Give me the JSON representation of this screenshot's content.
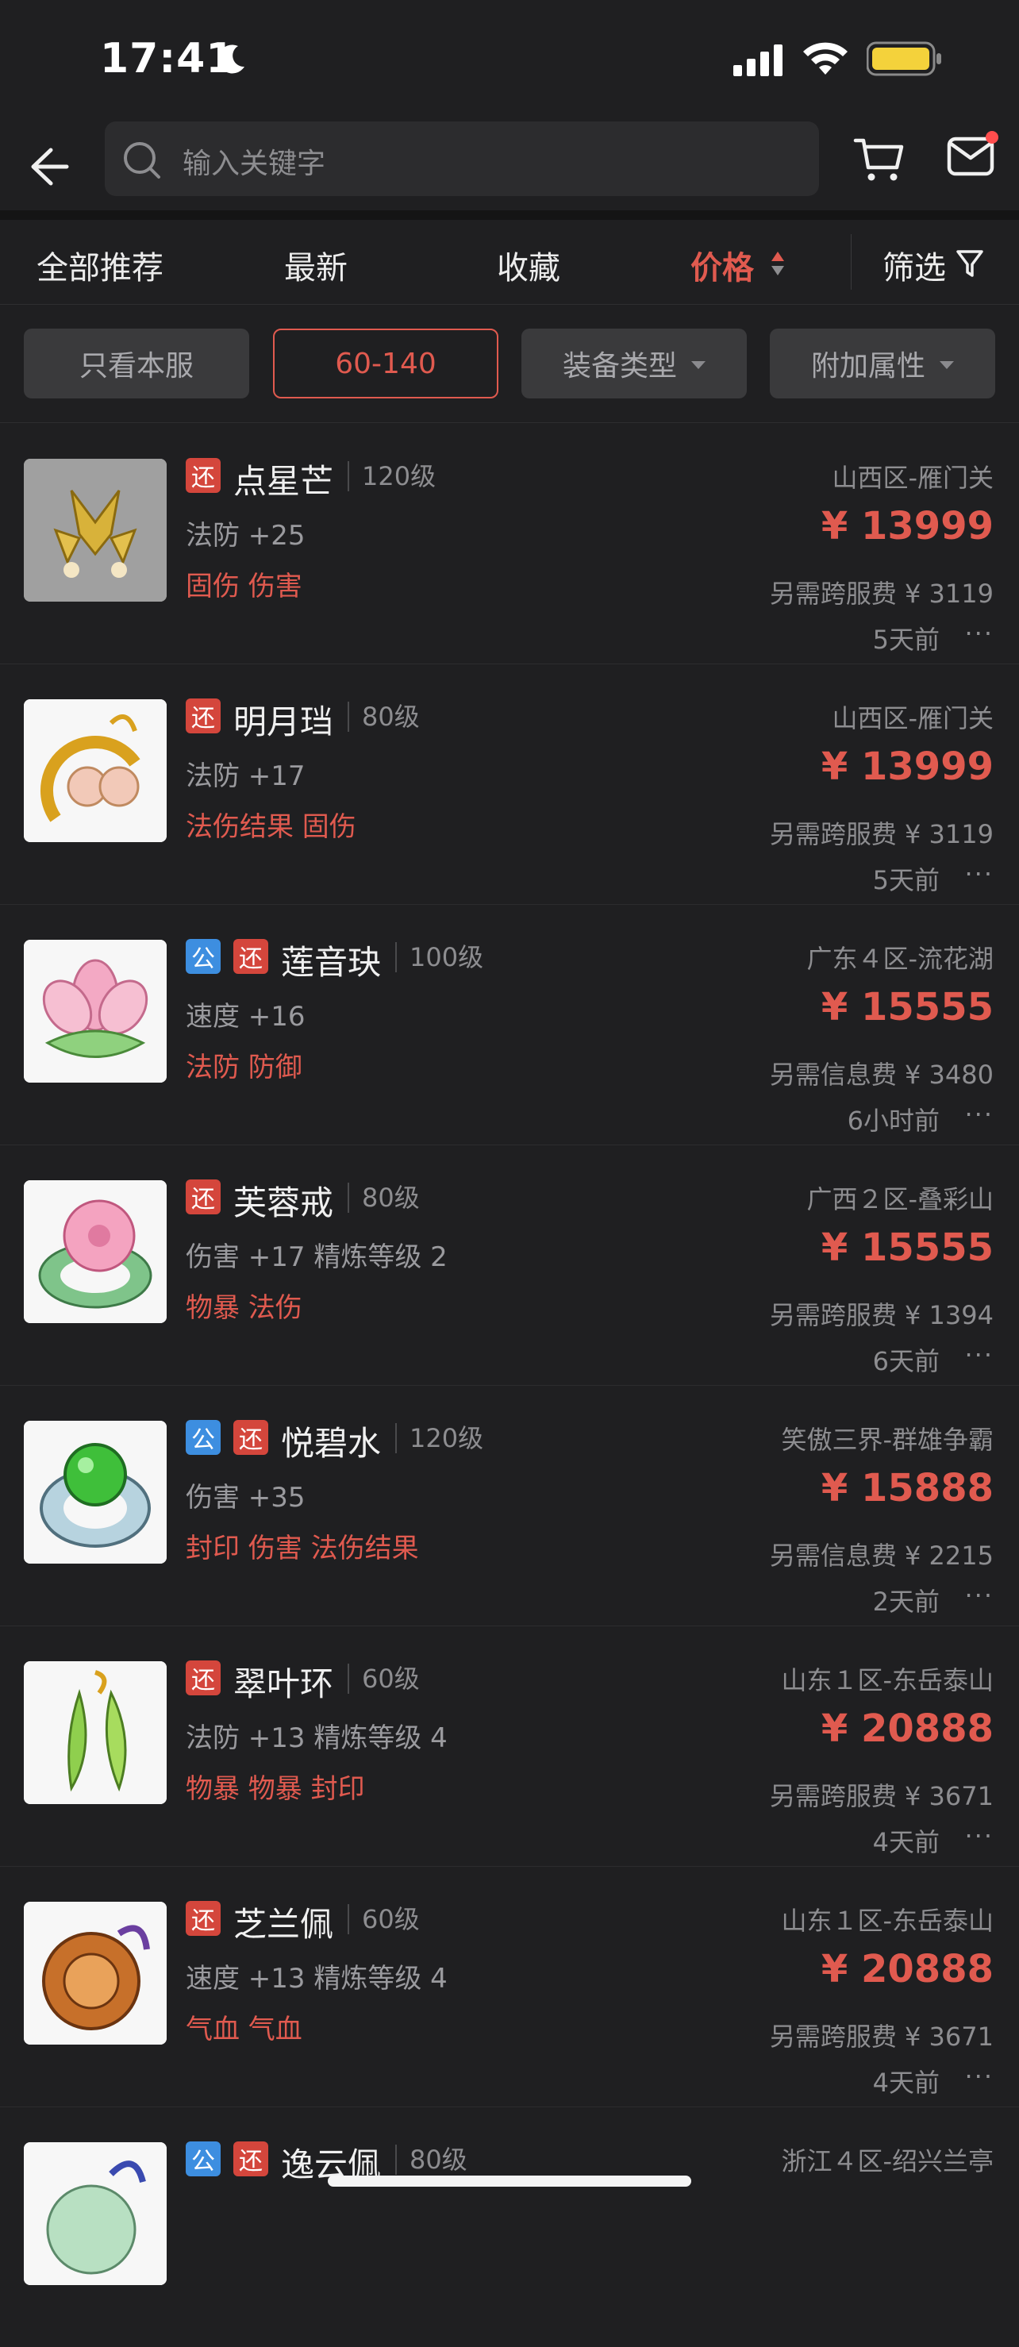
{
  "status_bar": {
    "time": "17:41"
  },
  "search": {
    "placeholder": "输入关键字"
  },
  "tabs": [
    {
      "label": "全部推荐"
    },
    {
      "label": "最新"
    },
    {
      "label": "收藏"
    },
    {
      "label": "价格",
      "active": true
    },
    {
      "label": "筛选"
    }
  ],
  "chips": [
    {
      "label": "只看本服"
    },
    {
      "label": "60-140",
      "selected": true
    },
    {
      "label": "装备类型"
    },
    {
      "label": "附加属性"
    }
  ],
  "items": [
    {
      "badges": [
        "还"
      ],
      "name": "点星芒",
      "level": "120级",
      "attr": "法防 +25",
      "tags": "固伤 伤害",
      "server": "山西区-雁门关",
      "price": "¥ 13999",
      "fee": "另需跨服费 ¥ 3119",
      "ago": "5天前"
    },
    {
      "badges": [
        "还"
      ],
      "name": "明月珰",
      "level": "80级",
      "attr": "法防 +17",
      "tags": "法伤结果 固伤",
      "server": "山西区-雁门关",
      "price": "¥ 13999",
      "fee": "另需跨服费 ¥ 3119",
      "ago": "5天前"
    },
    {
      "badges": [
        "公",
        "还"
      ],
      "name": "莲音玦",
      "level": "100级",
      "attr": "速度 +16",
      "tags": "法防 防御",
      "server": "广东４区-流花湖",
      "price": "¥ 15555",
      "fee": "另需信息费 ¥ 3480",
      "ago": "6小时前"
    },
    {
      "badges": [
        "还"
      ],
      "name": "芙蓉戒",
      "level": "80级",
      "attr": "伤害 +17 精炼等级 2",
      "tags": "物暴 法伤",
      "server": "广西２区-叠彩山",
      "price": "¥ 15555",
      "fee": "另需跨服费 ¥ 1394",
      "ago": "6天前"
    },
    {
      "badges": [
        "公",
        "还"
      ],
      "name": "悦碧水",
      "level": "120级",
      "attr": "伤害 +35",
      "tags": "封印 伤害 法伤结果",
      "server": "笑傲三界-群雄争霸",
      "price": "¥ 15888",
      "fee": "另需信息费 ¥ 2215",
      "ago": "2天前"
    },
    {
      "badges": [
        "还"
      ],
      "name": "翠叶环",
      "level": "60级",
      "attr": "法防 +13 精炼等级 4",
      "tags": "物暴 物暴 封印",
      "server": "山东１区-东岳泰山",
      "price": "¥ 20888",
      "fee": "另需跨服费 ¥ 3671",
      "ago": "4天前"
    },
    {
      "badges": [
        "还"
      ],
      "name": "芝兰佩",
      "level": "60级",
      "attr": "速度 +13 精炼等级 4",
      "tags": "气血 气血",
      "server": "山东１区-东岳泰山",
      "price": "¥ 20888",
      "fee": "另需跨服费 ¥ 3671",
      "ago": "4天前"
    },
    {
      "badges": [
        "公",
        "还"
      ],
      "name": "逸云佩",
      "level": "80级",
      "attr": "",
      "tags": "",
      "server": "浙江４区-绍兴兰亭",
      "price": "",
      "fee": "",
      "ago": ""
    }
  ],
  "colors": {
    "accent": "#e05a4f",
    "badge_public": "#3d8ee0",
    "badge_return": "#d4463c",
    "background": "#1f1f21"
  },
  "icons": [
    "back-arrow-icon",
    "search-icon",
    "cart-icon",
    "mail-icon",
    "sort-arrows-icon",
    "filter-funnel-icon",
    "more-dots-icon",
    "moon-icon",
    "signal-icon",
    "wifi-icon",
    "battery-icon"
  ]
}
